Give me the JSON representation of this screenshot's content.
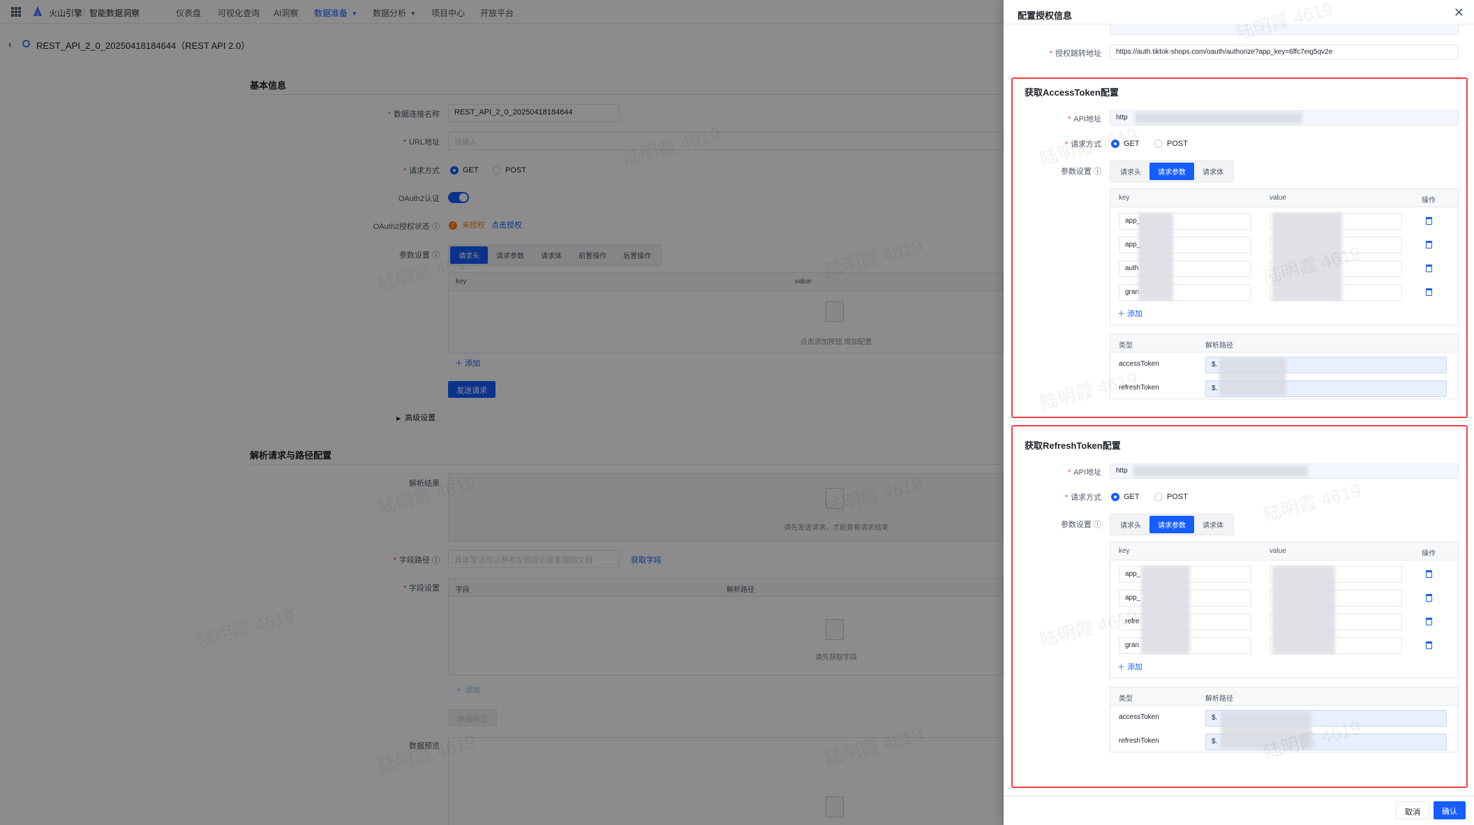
{
  "nav": {
    "brand": "火山引擎",
    "product": "智能数据洞察",
    "items": [
      "仪表盘",
      "可视化查询",
      "AI洞察",
      "数据准备",
      "数据分析",
      "项目中心",
      "开放平台"
    ],
    "active": "数据准备"
  },
  "page": {
    "title": "REST_API_2_0_20250418184644（REST API 2.0）"
  },
  "basic": {
    "section_title": "基本信息",
    "name_label": "数据连接名称",
    "name_value": "REST_API_2_0_20250418184644",
    "url_label": "URL地址",
    "url_placeholder": "请输入",
    "method_label": "请求方式",
    "method_get": "GET",
    "method_post": "POST",
    "oauth_label": "OAuth2认证",
    "oauth_status_label": "OAuth2授权状态",
    "oauth_status": "未授权",
    "oauth_action": "点击授权",
    "params_label": "参数设置",
    "tabs": [
      "请求头",
      "请求参数",
      "请求体",
      "前置操作",
      "后置操作"
    ],
    "col_key": "key",
    "col_value": "value",
    "empty_text": "点击添加按钮,增加配置",
    "add": "添加",
    "send": "发送请求",
    "advanced": "高级设置"
  },
  "parse": {
    "section_title": "解析请求与路径配置",
    "result_label": "解析结果",
    "result_empty": "请先发送请求，才能查看请求结果",
    "field_path_label": "字段路径",
    "field_path_placeholder": "具体写法可以参考左侧提示或者帮助文档",
    "get_fields": "获取字段",
    "field_settings_label": "字段设置",
    "col_field": "字段",
    "col_path": "解析路径",
    "fields_empty": "请先获取字段",
    "add": "添加",
    "preview_btn": "数据预览",
    "preview_label": "数据预览"
  },
  "drawer": {
    "title": "配置授权信息",
    "redirect_label": "授权跳转地址",
    "redirect_value": "https://auth.tiktok-shops.com/oauth/authorize?app_key=6ffc7eig5qv2e",
    "access": {
      "title": "获取AccessToken配置",
      "api_label": "API地址",
      "api_value": "http",
      "method_label": "请求方式",
      "get": "GET",
      "post": "POST",
      "params_label": "参数设置",
      "tabs": [
        "请求头",
        "请求参数",
        "请求体"
      ],
      "col_key": "key",
      "col_value": "value",
      "col_op": "操作",
      "rows": [
        "app_",
        "app_",
        "auth",
        "gran"
      ],
      "add": "添加",
      "col_type": "类型",
      "col_path": "解析路径",
      "tokens": [
        {
          "type": "accessToken",
          "path": "$."
        },
        {
          "type": "refreshToken",
          "path": "$."
        }
      ]
    },
    "refresh": {
      "title": "获取RefreshToken配置",
      "api_label": "API地址",
      "api_value": "http",
      "method_label": "请求方式",
      "get": "GET",
      "post": "POST",
      "params_label": "参数设置",
      "tabs": [
        "请求头",
        "请求参数",
        "请求体"
      ],
      "col_key": "key",
      "col_value": "value",
      "col_op": "操作",
      "rows": [
        "app_",
        "app_",
        "refre",
        "gran"
      ],
      "add": "添加",
      "col_type": "类型",
      "col_path": "解析路径",
      "tokens": [
        {
          "type": "accessToken",
          "path": "$."
        },
        {
          "type": "refreshToken",
          "path": "$."
        }
      ]
    },
    "cancel": "取消",
    "confirm": "确认"
  },
  "watermark": "陆明霞 4619"
}
